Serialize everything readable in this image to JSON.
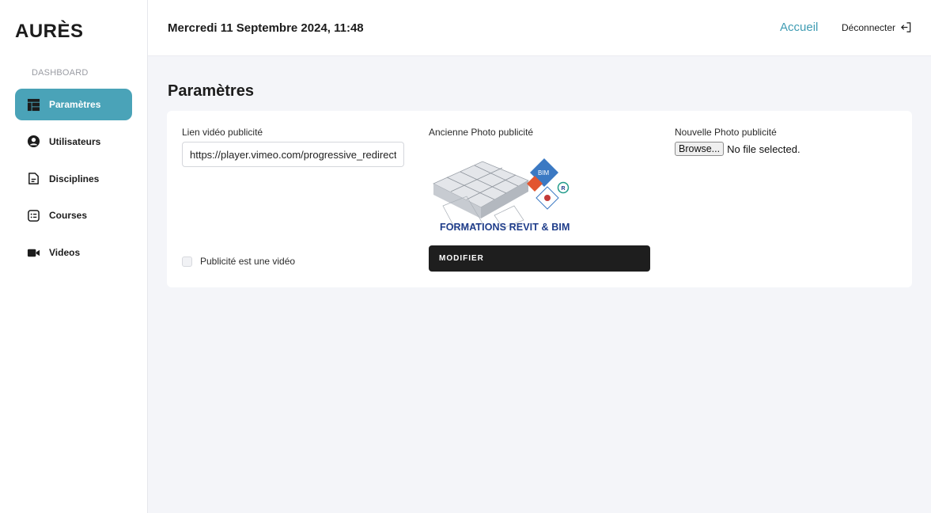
{
  "sidebar": {
    "brand": "AURÈS",
    "section_label": "DASHBOARD",
    "items": [
      {
        "label": "Paramètres",
        "icon": "table-layout-icon",
        "active": true
      },
      {
        "label": "Utilisateurs",
        "icon": "user-circle-icon",
        "active": false
      },
      {
        "label": "Disciplines",
        "icon": "document-icon",
        "active": false
      },
      {
        "label": "Courses",
        "icon": "list-card-icon",
        "active": false
      },
      {
        "label": "Videos",
        "icon": "video-camera-icon",
        "active": false
      }
    ]
  },
  "header": {
    "datetime": "Mercredi 11 Septembre 2024, 11:48",
    "home_link": "Accueil",
    "logout_label": "Déconnecter"
  },
  "main": {
    "title": "Paramètres",
    "form": {
      "video_link_label": "Lien vidéo publicité",
      "video_link_value": "https://player.vimeo.com/progressive_redirect",
      "old_photo_label": "Ancienne Photo publicité",
      "old_photo_caption": "FORMATIONS REVIT & BIM",
      "new_photo_label": "Nouvelle Photo publicité",
      "browse_label": "Browse...",
      "no_file_text": "No file selected.",
      "is_video_label": "Publicité est une vidéo",
      "is_video_checked": false,
      "submit_label": "MODIFIER"
    }
  },
  "colors": {
    "accent": "#4aa3b8",
    "link": "#3f9cb3",
    "button_dark": "#1e1e1e",
    "background": "#f4f5f9"
  }
}
